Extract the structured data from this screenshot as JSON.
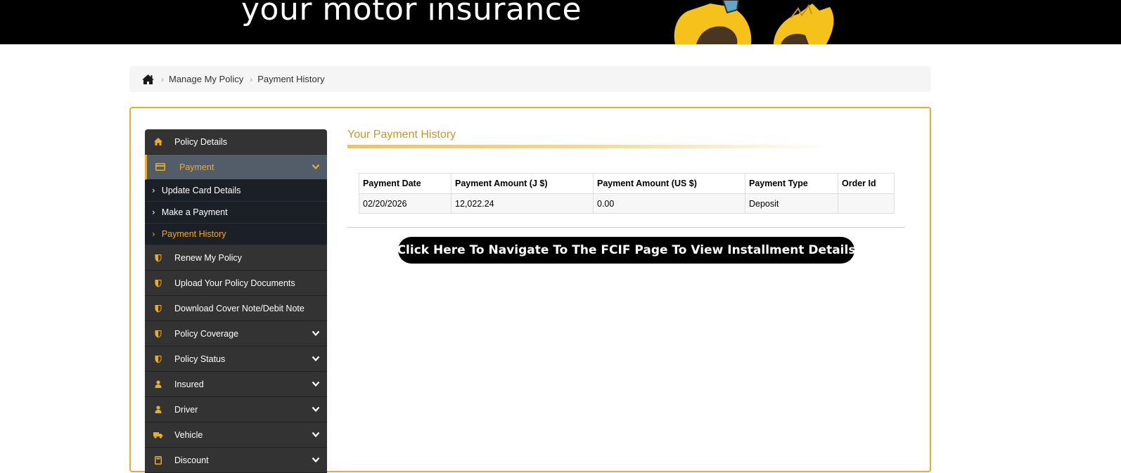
{
  "banner": {
    "tagline": "your motor insurance",
    "mascot_icon": "bird-mascot-icon"
  },
  "breadcrumb": {
    "home_icon": "home-icon",
    "items": [
      "Manage My Policy",
      "Payment History"
    ]
  },
  "sidebar": {
    "items": [
      {
        "label": "Policy Details",
        "icon": "home-icon"
      },
      {
        "label": "Payment",
        "icon": "credit-card-icon",
        "active": true
      },
      {
        "label": "Renew My Policy",
        "icon": "shield-icon"
      },
      {
        "label": "Upload Your Policy Documents",
        "icon": "shield-icon"
      },
      {
        "label": "Download Cover Note/Debit Note",
        "icon": "shield-icon"
      },
      {
        "label": "Policy Coverage",
        "icon": "shield-icon"
      },
      {
        "label": "Policy Status",
        "icon": "shield-icon"
      },
      {
        "label": "Insured",
        "icon": "user-icon"
      },
      {
        "label": "Driver",
        "icon": "user-icon"
      },
      {
        "label": "Vehicle",
        "icon": "truck-icon"
      },
      {
        "label": "Discount",
        "icon": "calculator-icon"
      }
    ],
    "payment_sub": [
      {
        "label": "Update Card Details"
      },
      {
        "label": "Make a Payment"
      },
      {
        "label": "Payment History",
        "current": true
      }
    ]
  },
  "main": {
    "title": "Your Payment History",
    "table": {
      "headers": [
        "Payment Date",
        "Payment Amount (J $)",
        "Payment Amount (US $)",
        "Payment Type",
        "Order Id"
      ],
      "rows": [
        [
          "02/20/2026",
          "12,022.24",
          "0.00",
          "Deposit",
          ""
        ]
      ]
    },
    "fcif_button": "Click Here To Navigate To The FCIF Page To View Installment Details"
  },
  "colors": {
    "accent": "#e8ad2e",
    "sidebar_bg": "#333333",
    "submenu_bg": "#1b1f26",
    "active_bg": "#525d69"
  }
}
